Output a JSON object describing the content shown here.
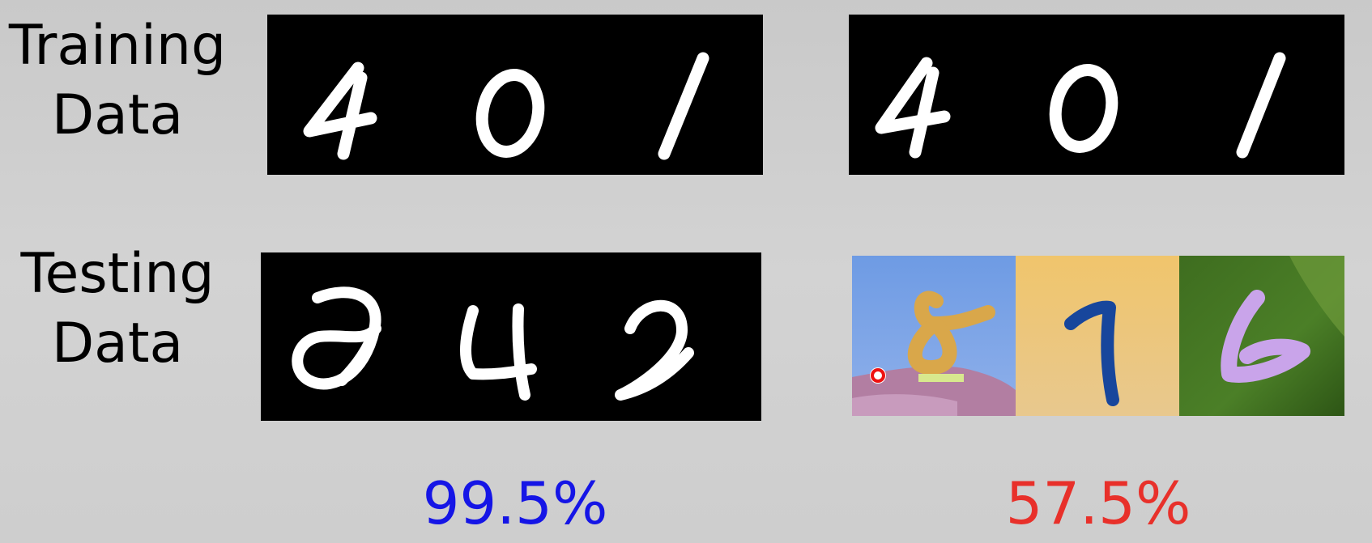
{
  "labels": {
    "training": [
      "Training",
      "Data"
    ],
    "testing": [
      "Testing",
      "Data"
    ]
  },
  "accuracy": {
    "mnist": "99.5%",
    "mnist_m": "57.5%"
  },
  "colors": {
    "background": "#cfcfcf",
    "digit_panel": "#000000",
    "mnist_accuracy": "#1515e6",
    "mnist_m_accuracy": "#e8302a"
  },
  "panels": {
    "left_training_digits": [
      "4",
      "0",
      "1"
    ],
    "right_training_digits": [
      "4",
      "0",
      "1"
    ],
    "left_testing_digits": [
      "9",
      "4",
      "2"
    ],
    "right_testing_digits": [
      "8",
      "1",
      "6"
    ]
  }
}
